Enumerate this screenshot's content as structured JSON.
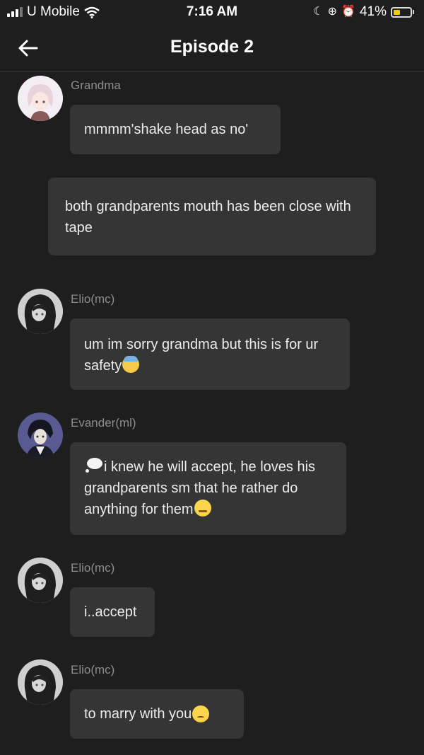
{
  "status": {
    "carrier": "U Mobile",
    "time": "7:16 AM",
    "battery": "41%",
    "battery_level": 0.41,
    "battery_color": "#f5cc00"
  },
  "header": {
    "title": "Episode 2",
    "back_icon": "arrow-left-icon"
  },
  "messages": [
    {
      "sender": "Grandma",
      "text": "mmmm'shake head as no'"
    },
    {
      "sender": "",
      "text": "both grandparents mouth has been close with tape"
    },
    {
      "sender": "Elio(mc)",
      "text": "um im sorry grandma but this is for ur safety",
      "emoji": "sweat-face"
    },
    {
      "sender": "Evander(ml)",
      "text": "i knew he will accept, he loves his grandparents sm that he rather do anything for them",
      "lead_emoji": "thought-bubble",
      "emoji": "smirk-face"
    },
    {
      "sender": "Elio(mc)",
      "text": "i..accept"
    },
    {
      "sender": "Elio(mc)",
      "text": "to marry with you",
      "emoji": "confused-face"
    }
  ]
}
